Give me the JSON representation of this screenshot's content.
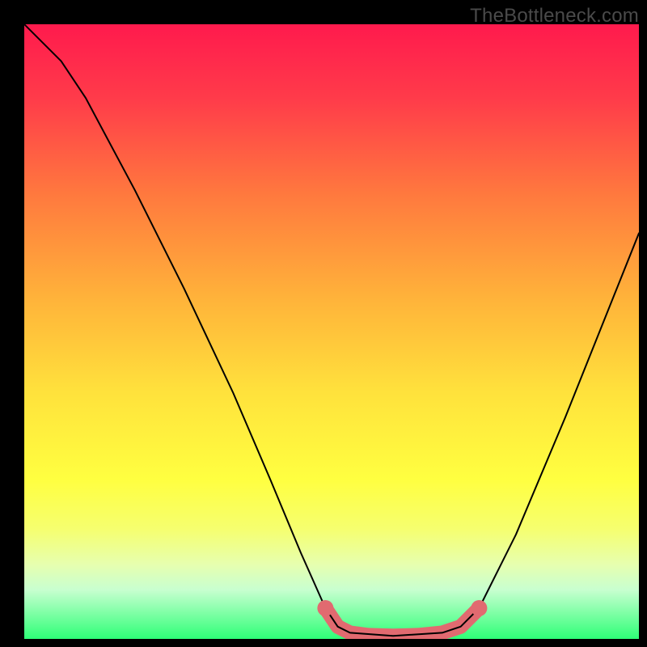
{
  "watermark": "TheBottleneck.com",
  "chart_data": {
    "type": "line",
    "title": "",
    "xlabel": "",
    "ylabel": "",
    "xlim": [
      0,
      100
    ],
    "ylim": [
      0,
      100
    ],
    "gradient_stops": [
      {
        "pos": 0,
        "color": "#ff1a4d"
      },
      {
        "pos": 12,
        "color": "#ff3b4a"
      },
      {
        "pos": 28,
        "color": "#ff7a3e"
      },
      {
        "pos": 45,
        "color": "#ffb43a"
      },
      {
        "pos": 60,
        "color": "#ffe23c"
      },
      {
        "pos": 74,
        "color": "#ffff40"
      },
      {
        "pos": 82,
        "color": "#f6ff6e"
      },
      {
        "pos": 88,
        "color": "#e6ffb0"
      },
      {
        "pos": 92,
        "color": "#c8ffd0"
      },
      {
        "pos": 100,
        "color": "#2eff77"
      }
    ],
    "series": [
      {
        "name": "bottleneck-curve",
        "color": "#000000",
        "points": [
          {
            "x": 0,
            "y": 100
          },
          {
            "x": 6,
            "y": 94
          },
          {
            "x": 10,
            "y": 88
          },
          {
            "x": 18,
            "y": 73
          },
          {
            "x": 26,
            "y": 57
          },
          {
            "x": 34,
            "y": 40
          },
          {
            "x": 40,
            "y": 26
          },
          {
            "x": 45,
            "y": 14
          },
          {
            "x": 49,
            "y": 5
          },
          {
            "x": 51,
            "y": 2
          },
          {
            "x": 53,
            "y": 1
          },
          {
            "x": 60,
            "y": 0.5
          },
          {
            "x": 68,
            "y": 1
          },
          {
            "x": 71,
            "y": 2
          },
          {
            "x": 74,
            "y": 5
          },
          {
            "x": 80,
            "y": 17
          },
          {
            "x": 88,
            "y": 36
          },
          {
            "x": 96,
            "y": 56
          },
          {
            "x": 100,
            "y": 66
          }
        ]
      },
      {
        "name": "marker-band",
        "color": "#e16a70",
        "points": [
          {
            "x": 49,
            "y": 5
          },
          {
            "x": 51,
            "y": 2
          },
          {
            "x": 53,
            "y": 1
          },
          {
            "x": 56,
            "y": 0.6
          },
          {
            "x": 60,
            "y": 0.5
          },
          {
            "x": 64,
            "y": 0.6
          },
          {
            "x": 68,
            "y": 1
          },
          {
            "x": 71,
            "y": 2
          },
          {
            "x": 74,
            "y": 5
          }
        ]
      }
    ]
  }
}
